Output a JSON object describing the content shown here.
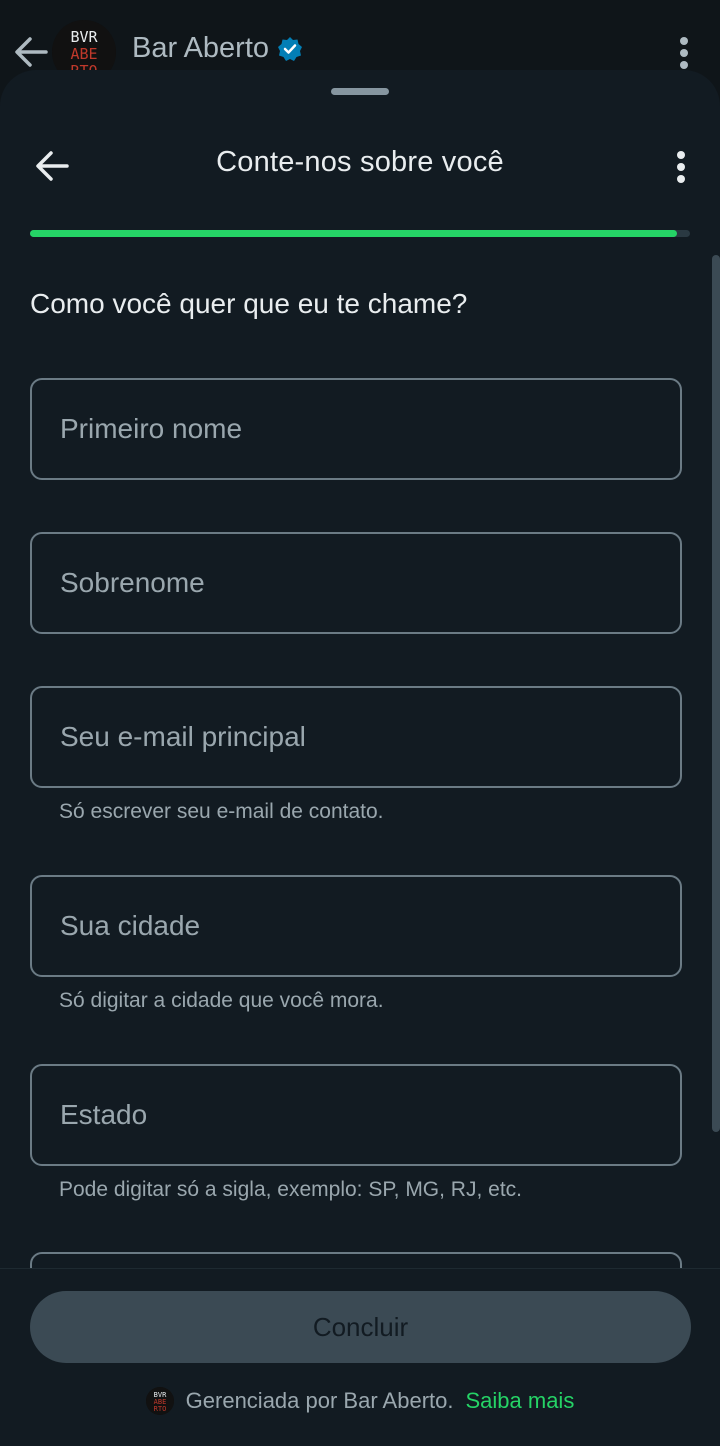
{
  "chat_header": {
    "title": "Bar Aberto",
    "logo_text": [
      "BVR",
      "ABE",
      "RTO"
    ]
  },
  "sheet": {
    "title": "Conte-nos sobre você",
    "progress": 0.98,
    "question": "Como você quer que eu te chame?",
    "fields": [
      {
        "placeholder": "Primeiro nome",
        "value": ""
      },
      {
        "placeholder": "Sobrenome",
        "value": ""
      },
      {
        "placeholder": "Seu e-mail principal",
        "value": "",
        "helper": "Só escrever seu e-mail de contato."
      },
      {
        "placeholder": "Sua cidade",
        "value": "",
        "helper": "Só digitar a cidade que você mora."
      },
      {
        "placeholder": "Estado",
        "value": "",
        "helper": "Pode digitar só a sigla, exemplo: SP, MG, RJ, etc."
      }
    ]
  },
  "footer": {
    "button_label": "Concluir",
    "managed_text": "Gerenciada por Bar Aberto.",
    "learn_more": "Saiba mais"
  },
  "colors": {
    "accent": "#25d366",
    "verified": "#027eb5",
    "sheet_bg": "#121b22"
  },
  "icons": [
    "back-arrow-icon",
    "verified-badge-icon",
    "more-vert-icon"
  ]
}
